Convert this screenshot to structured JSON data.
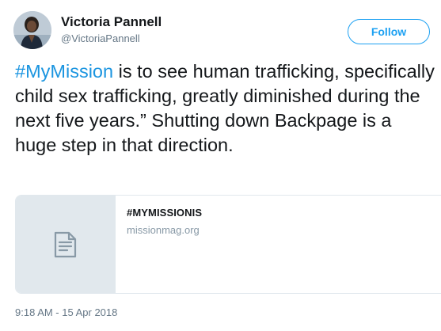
{
  "author": {
    "display_name": "Victoria Pannell",
    "handle": "@VictoriaPannell",
    "avatar_icon": "user-avatar"
  },
  "follow_button": {
    "label": "Follow",
    "color": "#1da1f2"
  },
  "tweet": {
    "hashtag": "#MyMission",
    "text": " is to see human trafficking, specifically child sex trafficking, greatly diminished during the next five years.” Shutting down Backpage is a huge step in that direction.",
    "hashtag_color": "#1b95e0"
  },
  "link_card": {
    "title": "#MYMISSIONIS",
    "domain": "missionmag.org",
    "thumbnail_icon": "document-icon"
  },
  "timestamp": "9:18 AM - 15 Apr 2018"
}
